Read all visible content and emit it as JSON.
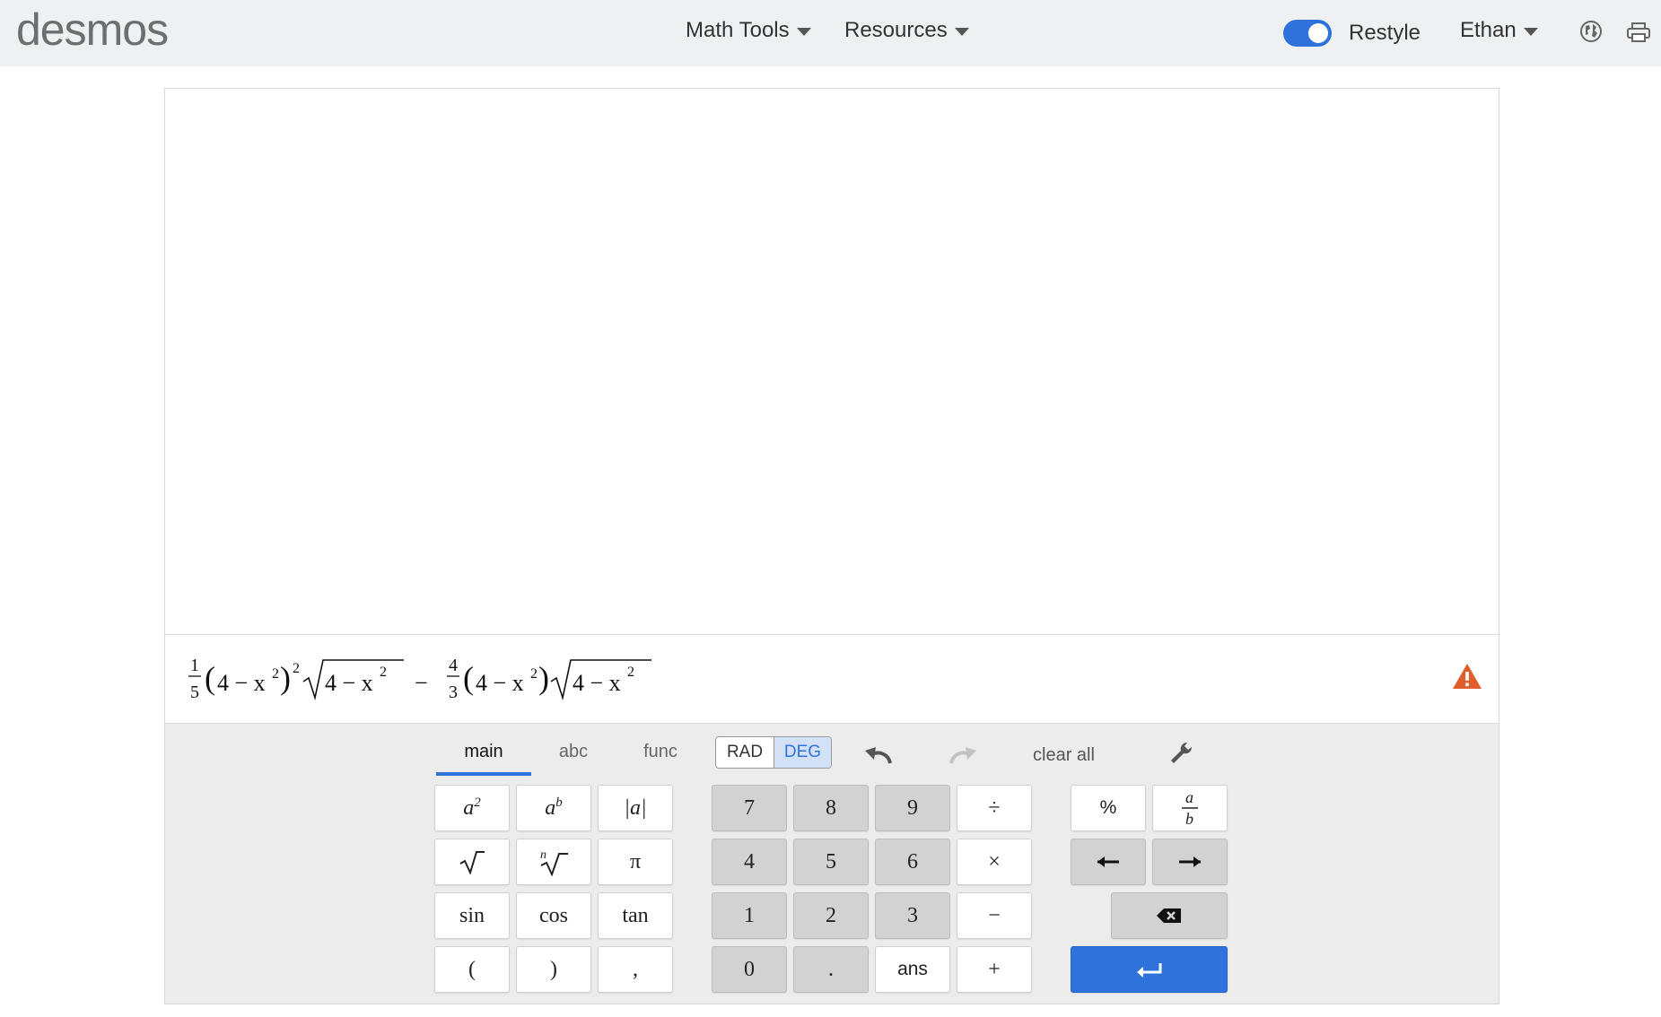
{
  "header": {
    "logo": "desmos",
    "menus": [
      {
        "label": "Math Tools"
      },
      {
        "label": "Resources"
      }
    ],
    "restyle_label": "Restyle",
    "restyle_on": true,
    "user": "Ethan",
    "icons": [
      "globe-icon",
      "print-icon"
    ],
    "accent": "#2f72dc"
  },
  "expression": {
    "parts": {
      "frac1_num": "1",
      "frac1_den": "5",
      "inner": "4 − x",
      "sq": "2",
      "minus": "−",
      "frac2_num": "4",
      "frac2_den": "3"
    },
    "warning_icon": "warning-triangle-icon",
    "warning_color": "#e05d2c"
  },
  "keypad": {
    "tabs": [
      "main",
      "abc",
      "func"
    ],
    "active_tab": "main",
    "angle_modes": [
      "RAD",
      "DEG"
    ],
    "selected_mode": "DEG",
    "clear_all": "clear all",
    "functions": {
      "row1": [
        "a",
        "a",
        "|a|"
      ],
      "row1_sups": [
        "2",
        "b"
      ],
      "row2_root_index": "n",
      "pi": "π",
      "trig": [
        "sin",
        "cos",
        "tan"
      ],
      "punct": [
        "(",
        ")",
        ","
      ]
    },
    "numbers": {
      "row1": [
        "7",
        "8",
        "9",
        "÷"
      ],
      "row2": [
        "4",
        "5",
        "6",
        "×"
      ],
      "row3": [
        "1",
        "2",
        "3",
        "−"
      ],
      "row4": [
        "0",
        ".",
        "ans",
        "+"
      ]
    },
    "extras": {
      "percent": "%",
      "frac_num": "a",
      "frac_den": "b"
    }
  }
}
